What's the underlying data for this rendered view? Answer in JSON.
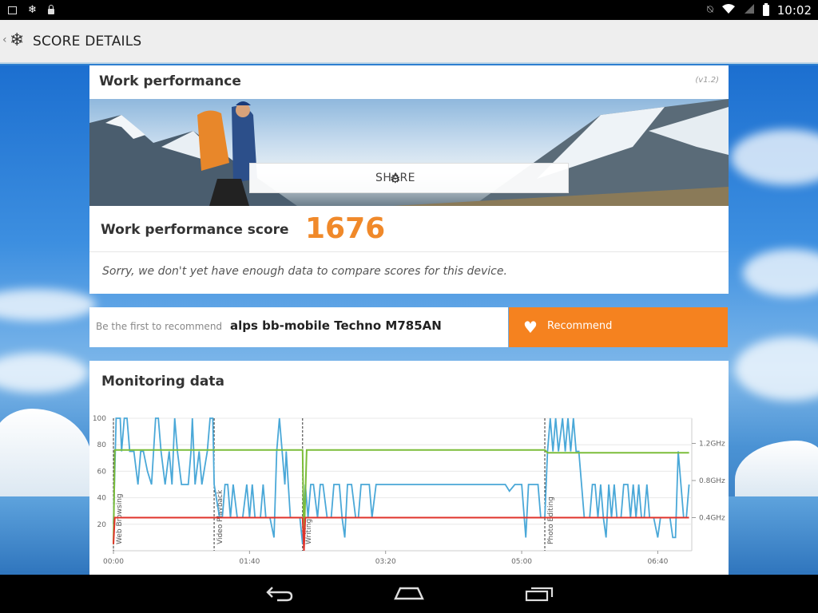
{
  "status_bar": {
    "time": "10:02",
    "icons": [
      "image-icon",
      "snowflake-icon",
      "lock-icon",
      "mute-icon",
      "wifi-icon",
      "signal-icon",
      "battery-icon"
    ]
  },
  "action_bar": {
    "title": "SCORE DETAILS"
  },
  "work_performance": {
    "heading": "Work performance",
    "version": "(v1.2)",
    "share_label": "SHARE",
    "score_label": "Work performance score",
    "score_value": "1676",
    "note": "Sorry, we don't yet have enough data to compare scores for this device."
  },
  "recommend": {
    "prefix": "Be the first to recommend",
    "device": "alps bb-mobile Techno M785AN",
    "button_label": "Recommend"
  },
  "colors": {
    "accent_orange": "#f5821f",
    "score_orange": "#f0892a",
    "series_score": "#4aa8d8",
    "series_freq": "#7cbd3a",
    "series_temp": "#e0332b"
  },
  "monitoring": {
    "heading": "Monitoring data",
    "chart_data": {
      "type": "line",
      "x_ticks": [
        "00:00",
        "01:40",
        "03:20",
        "05:00",
        "06:40"
      ],
      "y_left_ticks": [
        "20",
        "40",
        "60",
        "80",
        "100"
      ],
      "y_right_ticks": [
        "0.4GHz",
        "0.8GHz",
        "1.2GHz"
      ],
      "xlim_seconds": [
        0,
        425
      ],
      "ylim": [
        0,
        100
      ],
      "sections": [
        {
          "label": "Web Browsing",
          "start": 0
        },
        {
          "label": "Video Playback",
          "start": 74
        },
        {
          "label": "Writing",
          "start": 139
        },
        {
          "label": "Photo Editing",
          "start": 317
        }
      ],
      "series": [
        {
          "name": "",
          "color": "#4aa8d8",
          "points": [
            [
              0,
              20
            ],
            [
              2,
              100
            ],
            [
              5,
              100
            ],
            [
              6,
              75
            ],
            [
              8,
              100
            ],
            [
              10,
              100
            ],
            [
              12,
              75
            ],
            [
              15,
              75
            ],
            [
              18,
              50
            ],
            [
              20,
              75
            ],
            [
              22,
              75
            ],
            [
              25,
              60
            ],
            [
              28,
              50
            ],
            [
              31,
              100
            ],
            [
              33,
              100
            ],
            [
              35,
              75
            ],
            [
              38,
              50
            ],
            [
              41,
              75
            ],
            [
              43,
              50
            ],
            [
              45,
              100
            ],
            [
              47,
              75
            ],
            [
              50,
              50
            ],
            [
              55,
              50
            ],
            [
              57,
              75
            ],
            [
              58,
              100
            ],
            [
              60,
              50
            ],
            [
              63,
              75
            ],
            [
              65,
              50
            ],
            [
              69,
              75
            ],
            [
              71,
              100
            ],
            [
              73,
              100
            ],
            [
              74,
              50
            ],
            [
              78,
              25
            ],
            [
              80,
              25
            ],
            [
              82,
              50
            ],
            [
              84,
              50
            ],
            [
              86,
              25
            ],
            [
              88,
              50
            ],
            [
              91,
              25
            ],
            [
              95,
              25
            ],
            [
              98,
              50
            ],
            [
              100,
              25
            ],
            [
              102,
              50
            ],
            [
              104,
              25
            ],
            [
              108,
              25
            ],
            [
              110,
              50
            ],
            [
              112,
              25
            ],
            [
              115,
              25
            ],
            [
              118,
              10
            ],
            [
              120,
              75
            ],
            [
              122,
              100
            ],
            [
              124,
              75
            ],
            [
              126,
              50
            ],
            [
              127,
              75
            ],
            [
              130,
              25
            ],
            [
              134,
              25
            ],
            [
              137,
              25
            ],
            [
              139,
              5
            ],
            [
              141,
              50
            ],
            [
              143,
              25
            ],
            [
              145,
              50
            ],
            [
              147,
              50
            ],
            [
              150,
              25
            ],
            [
              152,
              50
            ],
            [
              154,
              50
            ],
            [
              157,
              25
            ],
            [
              160,
              25
            ],
            [
              162,
              50
            ],
            [
              166,
              50
            ],
            [
              168,
              25
            ],
            [
              170,
              10
            ],
            [
              172,
              50
            ],
            [
              175,
              50
            ],
            [
              178,
              25
            ],
            [
              180,
              25
            ],
            [
              182,
              50
            ],
            [
              188,
              50
            ],
            [
              190,
              25
            ],
            [
              193,
              50
            ],
            [
              198,
              50
            ],
            [
              208,
              50
            ],
            [
              218,
              50
            ],
            [
              228,
              50
            ],
            [
              238,
              50
            ],
            [
              248,
              50
            ],
            [
              258,
              50
            ],
            [
              268,
              50
            ],
            [
              278,
              50
            ],
            [
              288,
              50
            ],
            [
              291,
              45
            ],
            [
              295,
              50
            ],
            [
              300,
              50
            ],
            [
              303,
              10
            ],
            [
              305,
              50
            ],
            [
              309,
              50
            ],
            [
              312,
              50
            ],
            [
              314,
              25
            ],
            [
              317,
              25
            ],
            [
              319,
              75
            ],
            [
              321,
              100
            ],
            [
              323,
              75
            ],
            [
              325,
              100
            ],
            [
              327,
              75
            ],
            [
              330,
              100
            ],
            [
              332,
              75
            ],
            [
              334,
              100
            ],
            [
              336,
              75
            ],
            [
              338,
              100
            ],
            [
              340,
              75
            ],
            [
              342,
              75
            ],
            [
              344,
              50
            ],
            [
              346,
              25
            ],
            [
              350,
              25
            ],
            [
              352,
              50
            ],
            [
              354,
              50
            ],
            [
              356,
              25
            ],
            [
              358,
              50
            ],
            [
              360,
              25
            ],
            [
              362,
              10
            ],
            [
              364,
              50
            ],
            [
              366,
              25
            ],
            [
              368,
              50
            ],
            [
              370,
              25
            ],
            [
              373,
              25
            ],
            [
              375,
              50
            ],
            [
              378,
              50
            ],
            [
              380,
              25
            ],
            [
              382,
              50
            ],
            [
              384,
              25
            ],
            [
              386,
              50
            ],
            [
              388,
              25
            ],
            [
              390,
              25
            ],
            [
              392,
              50
            ],
            [
              394,
              25
            ],
            [
              397,
              25
            ],
            [
              400,
              10
            ],
            [
              402,
              25
            ],
            [
              405,
              25
            ],
            [
              407,
              25
            ],
            [
              409,
              25
            ],
            [
              411,
              10
            ],
            [
              413,
              10
            ],
            [
              415,
              75
            ],
            [
              417,
              50
            ],
            [
              419,
              25
            ],
            [
              421,
              25
            ],
            [
              423,
              50
            ]
          ]
        },
        {
          "name": "",
          "color": "#7cbd3a",
          "points": [
            [
              0,
              5
            ],
            [
              1,
              76
            ],
            [
              139,
              76
            ],
            [
              140,
              5
            ],
            [
              142,
              76
            ],
            [
              317,
              76
            ],
            [
              319,
              74
            ],
            [
              423,
              74
            ]
          ]
        },
        {
          "name": "",
          "color": "#e0332b",
          "points": [
            [
              0,
              5
            ],
            [
              1,
              25
            ],
            [
              139,
              25
            ],
            [
              140,
              0
            ],
            [
              141,
              25
            ],
            [
              423,
              25
            ]
          ]
        }
      ]
    }
  },
  "nav_bar": {
    "icons": [
      "back-icon",
      "home-icon",
      "recents-icon"
    ]
  }
}
